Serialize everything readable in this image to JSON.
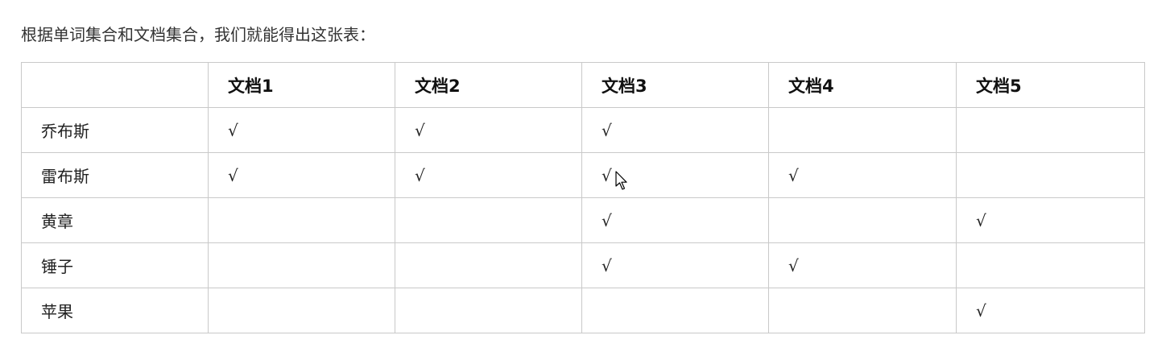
{
  "intro": "根据单词集合和文档集合，我们就能得出这张表：",
  "table": {
    "columns": [
      "",
      "文档1",
      "文档2",
      "文档3",
      "文档4",
      "文档5"
    ],
    "check_mark": "√",
    "rows": [
      {
        "term": "乔布斯",
        "cells": [
          "√",
          "√",
          "√",
          "",
          ""
        ]
      },
      {
        "term": "雷布斯",
        "cells": [
          "√",
          "√",
          "√",
          "√",
          ""
        ]
      },
      {
        "term": "黄章",
        "cells": [
          "",
          "",
          "√",
          "",
          "√"
        ]
      },
      {
        "term": "锤子",
        "cells": [
          "",
          "",
          "√",
          "√",
          ""
        ]
      },
      {
        "term": "苹果",
        "cells": [
          "",
          "",
          "",
          "",
          "√"
        ]
      }
    ]
  }
}
